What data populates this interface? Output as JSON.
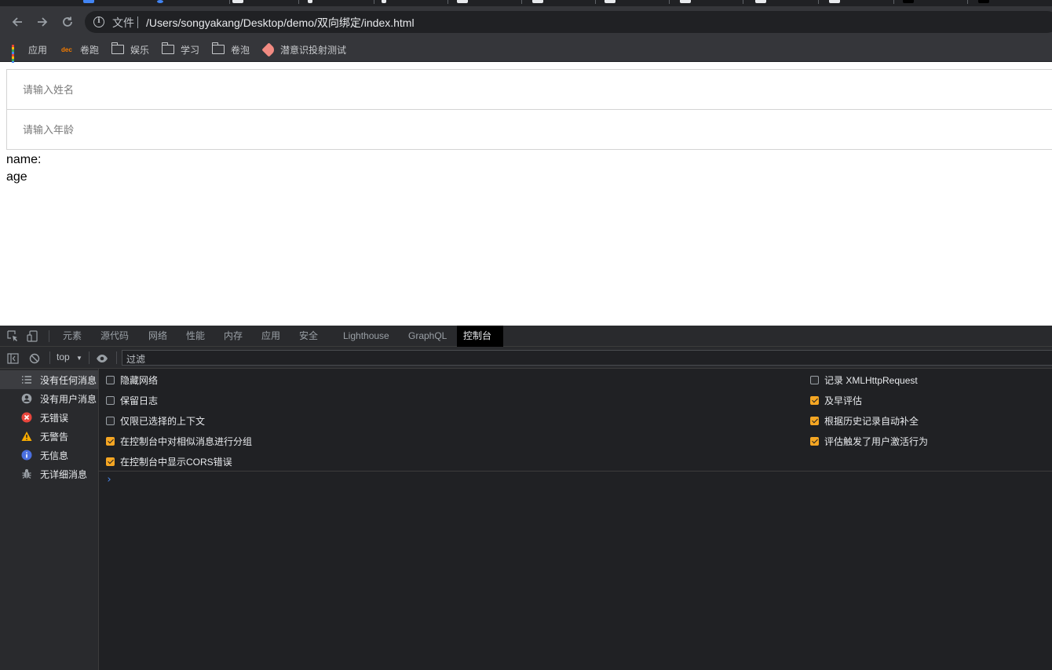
{
  "browser": {
    "scheme_label": "文件",
    "url": "/Users/songyakang/Desktop/demo/双向绑定/index.html",
    "nav": {
      "back_icon": "arrow-left",
      "forward_icon": "arrow-right",
      "reload_icon": "reload"
    }
  },
  "bookmarks": [
    {
      "label": "应用",
      "icon": "apps-grid-icon"
    },
    {
      "label": "卷跑",
      "icon": "dec-icon"
    },
    {
      "label": "娱乐",
      "icon": "folder-icon"
    },
    {
      "label": "学习",
      "icon": "folder-icon"
    },
    {
      "label": "卷泡",
      "icon": "folder-icon"
    },
    {
      "label": "潜意识投射测试",
      "icon": "tag-icon"
    }
  ],
  "page": {
    "name_placeholder": "请输入姓名",
    "age_placeholder": "请输入年龄",
    "name_output": "name:",
    "age_output": "age"
  },
  "devtools": {
    "tabs": [
      "元素",
      "源代码",
      "网络",
      "性能",
      "内存",
      "应用",
      "安全",
      "Lighthouse",
      "GraphQL",
      "控制台"
    ],
    "active_tab": "控制台",
    "context": "top",
    "filter_placeholder": "过滤",
    "sidebar": [
      {
        "label": "没有任何消息",
        "icon": "list-icon",
        "active": true
      },
      {
        "label": "没有用户消息",
        "icon": "user-icon",
        "active": false
      },
      {
        "label": "无错误",
        "icon": "error-icon",
        "active": false
      },
      {
        "label": "无警告",
        "icon": "warning-icon",
        "active": false
      },
      {
        "label": "无信息",
        "icon": "info-icon",
        "active": false
      },
      {
        "label": "无详细消息",
        "icon": "bug-icon",
        "active": false
      }
    ],
    "settings_left": [
      {
        "label": "隐藏网络",
        "checked": false
      },
      {
        "label": "保留日志",
        "checked": false
      },
      {
        "label": "仅限已选择的上下文",
        "checked": false
      },
      {
        "label": "在控制台中对相似消息进行分组",
        "checked": true
      },
      {
        "label": "在控制台中显示CORS错误",
        "checked": true
      }
    ],
    "settings_right": [
      {
        "label": "记录 XMLHttpRequest",
        "checked": false
      },
      {
        "label": "及早评估",
        "checked": true
      },
      {
        "label": "根据历史记录自动补全",
        "checked": true
      },
      {
        "label": "评估触发了用户激活行为",
        "checked": true
      }
    ],
    "prompt_symbol": "›"
  },
  "colors": {
    "chrome_bg": "#35363a",
    "devtools_bg": "#202124",
    "checkbox_on": "#f5a623",
    "error": "#e8453c",
    "warning": "#f9ab00",
    "info": "#4a6fe0"
  }
}
